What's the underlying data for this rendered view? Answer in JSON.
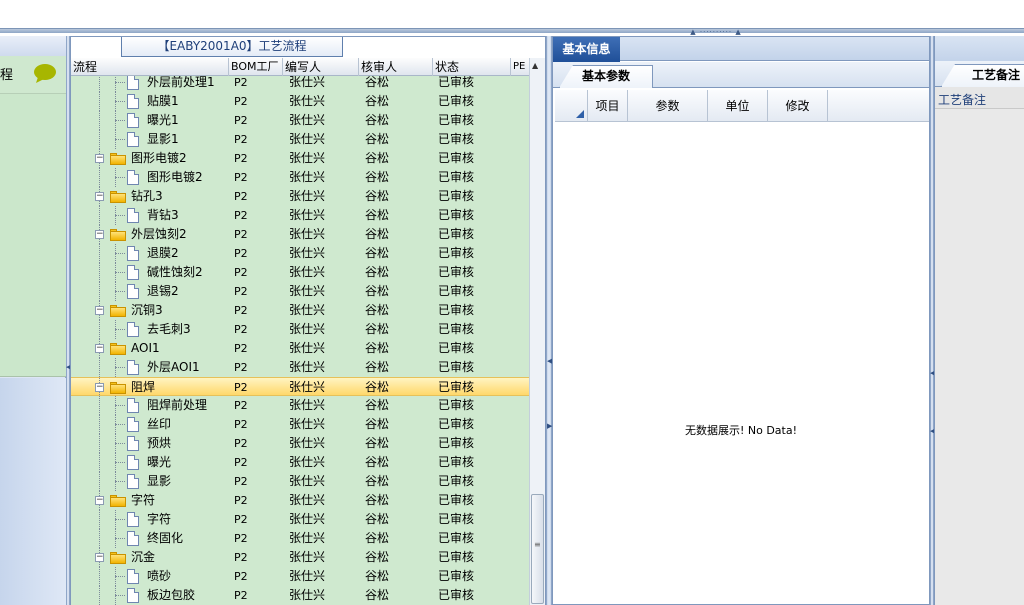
{
  "left_panel": {
    "label": "程"
  },
  "tree": {
    "caption": "【EABY2001A0】工艺流程",
    "columns": [
      "流程",
      "BOM工厂",
      "编写人",
      "核审人",
      "状态",
      "PE"
    ],
    "rows": [
      {
        "name": "外层前处理1",
        "level": 2,
        "type": "item",
        "factory": "P2",
        "writer": "张仕兴",
        "reviewer": "谷松",
        "status": "已审核"
      },
      {
        "name": "贴膜1",
        "level": 2,
        "type": "item",
        "factory": "P2",
        "writer": "张仕兴",
        "reviewer": "谷松",
        "status": "已审核"
      },
      {
        "name": "曝光1",
        "level": 2,
        "type": "item",
        "factory": "P2",
        "writer": "张仕兴",
        "reviewer": "谷松",
        "status": "已审核"
      },
      {
        "name": "显影1",
        "level": 2,
        "type": "item",
        "factory": "P2",
        "writer": "张仕兴",
        "reviewer": "谷松",
        "status": "已审核"
      },
      {
        "name": "图形电镀2",
        "level": 1,
        "type": "folder",
        "factory": "P2",
        "writer": "张仕兴",
        "reviewer": "谷松",
        "status": "已审核"
      },
      {
        "name": "图形电镀2",
        "level": 2,
        "type": "item",
        "factory": "P2",
        "writer": "张仕兴",
        "reviewer": "谷松",
        "status": "已审核"
      },
      {
        "name": "钻孔3",
        "level": 1,
        "type": "folder",
        "factory": "P2",
        "writer": "张仕兴",
        "reviewer": "谷松",
        "status": "已审核"
      },
      {
        "name": "背钻3",
        "level": 2,
        "type": "item",
        "factory": "P2",
        "writer": "张仕兴",
        "reviewer": "谷松",
        "status": "已审核"
      },
      {
        "name": "外层蚀刻2",
        "level": 1,
        "type": "folder",
        "factory": "P2",
        "writer": "张仕兴",
        "reviewer": "谷松",
        "status": "已审核"
      },
      {
        "name": "退膜2",
        "level": 2,
        "type": "item",
        "factory": "P2",
        "writer": "张仕兴",
        "reviewer": "谷松",
        "status": "已审核"
      },
      {
        "name": "碱性蚀刻2",
        "level": 2,
        "type": "item",
        "factory": "P2",
        "writer": "张仕兴",
        "reviewer": "谷松",
        "status": "已审核"
      },
      {
        "name": "退锡2",
        "level": 2,
        "type": "item",
        "factory": "P2",
        "writer": "张仕兴",
        "reviewer": "谷松",
        "status": "已审核"
      },
      {
        "name": "沉铜3",
        "level": 1,
        "type": "folder",
        "factory": "P2",
        "writer": "张仕兴",
        "reviewer": "谷松",
        "status": "已审核"
      },
      {
        "name": "去毛刺3",
        "level": 2,
        "type": "item",
        "factory": "P2",
        "writer": "张仕兴",
        "reviewer": "谷松",
        "status": "已审核"
      },
      {
        "name": "AOI1",
        "level": 1,
        "type": "folder",
        "factory": "P2",
        "writer": "张仕兴",
        "reviewer": "谷松",
        "status": "已审核"
      },
      {
        "name": "外层AOI1",
        "level": 2,
        "type": "item",
        "factory": "P2",
        "writer": "张仕兴",
        "reviewer": "谷松",
        "status": "已审核"
      },
      {
        "name": "阻焊",
        "level": 1,
        "type": "folder",
        "factory": "P2",
        "writer": "张仕兴",
        "reviewer": "谷松",
        "status": "已审核",
        "selected": true
      },
      {
        "name": "阻焊前处理",
        "level": 2,
        "type": "item",
        "factory": "P2",
        "writer": "张仕兴",
        "reviewer": "谷松",
        "status": "已审核"
      },
      {
        "name": "丝印",
        "level": 2,
        "type": "item",
        "factory": "P2",
        "writer": "张仕兴",
        "reviewer": "谷松",
        "status": "已审核"
      },
      {
        "name": "预烘",
        "level": 2,
        "type": "item",
        "factory": "P2",
        "writer": "张仕兴",
        "reviewer": "谷松",
        "status": "已审核"
      },
      {
        "name": "曝光",
        "level": 2,
        "type": "item",
        "factory": "P2",
        "writer": "张仕兴",
        "reviewer": "谷松",
        "status": "已审核"
      },
      {
        "name": "显影",
        "level": 2,
        "type": "item",
        "factory": "P2",
        "writer": "张仕兴",
        "reviewer": "谷松",
        "status": "已审核"
      },
      {
        "name": "字符",
        "level": 1,
        "type": "folder",
        "factory": "P2",
        "writer": "张仕兴",
        "reviewer": "谷松",
        "status": "已审核"
      },
      {
        "name": "字符",
        "level": 2,
        "type": "item",
        "factory": "P2",
        "writer": "张仕兴",
        "reviewer": "谷松",
        "status": "已审核"
      },
      {
        "name": "终固化",
        "level": 2,
        "type": "item",
        "factory": "P2",
        "writer": "张仕兴",
        "reviewer": "谷松",
        "status": "已审核"
      },
      {
        "name": "沉金",
        "level": 1,
        "type": "folder",
        "factory": "P2",
        "writer": "张仕兴",
        "reviewer": "谷松",
        "status": "已审核"
      },
      {
        "name": "喷砂",
        "level": 2,
        "type": "item",
        "factory": "P2",
        "writer": "张仕兴",
        "reviewer": "谷松",
        "status": "已审核"
      },
      {
        "name": "板边包胶",
        "level": 2,
        "type": "item",
        "factory": "P2",
        "writer": "张仕兴",
        "reviewer": "谷松",
        "status": "已审核"
      }
    ]
  },
  "center": {
    "top_tab": "基本信息",
    "sub_tab": "基本参数",
    "columns": [
      "项目",
      "参数",
      "单位",
      "修改"
    ],
    "empty_text": "无数据展示! No Data!"
  },
  "right": {
    "tab": "工艺备注",
    "label": "工艺备注"
  },
  "colors": {
    "tree_bg": "#cfe9cf",
    "selected_row": "#ffd86b",
    "tab_active": "#1f4f98"
  }
}
